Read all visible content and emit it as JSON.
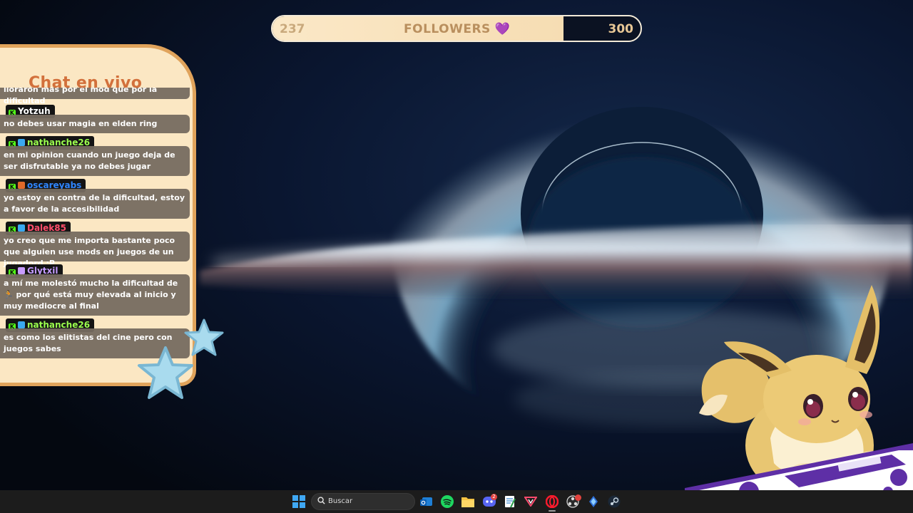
{
  "followers": {
    "current": "237",
    "label": "FOLLOWERS",
    "heart": "💜",
    "goal": "300",
    "progress": 0.79
  },
  "chat": {
    "title": "Chat en vivo",
    "truncated_line": "lloraron más por el mod que por la dificultad",
    "messages": [
      {
        "user": "Yotzuh",
        "user_color": "#ffffff",
        "badges": [
          "kick"
        ],
        "text": "no debes usar magia en elden ring"
      },
      {
        "user": "nathanche26",
        "user_color": "#9bff4e",
        "badges": [
          "kick",
          "sub"
        ],
        "text": "en mi opinion cuando un juego deja de ser disfrutable ya no debes jugar"
      },
      {
        "user": "oscareyabs",
        "user_color": "#2f86ff",
        "badges": [
          "kick",
          "fire"
        ],
        "text": "yo estoy en contra de la dificultad, estoy a favor de la accesibilidad"
      },
      {
        "user": "Dalek85",
        "user_color": "#ff4f6c",
        "badges": [
          "kick",
          "sub"
        ],
        "text": "yo creo que me importa bastante poco que alguien use mods en juegos de un jugadord :P"
      },
      {
        "user": "Glytxil",
        "user_color": "#c49bff",
        "badges": [
          "kick",
          "gift"
        ],
        "text": "a mí me molestó mucho la dificultad de 🏃 por qué está muy elevada al inicio y muy mediocre al final"
      },
      {
        "user": "nathanche26",
        "user_color": "#9bff4e",
        "badges": [
          "kick",
          "sub"
        ],
        "text": "es como los elitistas del cine pero con juegos sabes"
      }
    ]
  },
  "taskbar": {
    "search_placeholder": "Buscar",
    "discord_badge": "2",
    "icons": [
      "windows-start-icon",
      "search-icon",
      "outlook-icon",
      "spotify-icon",
      "file-explorer-icon",
      "discord-icon",
      "notepad-icon",
      "streamlabs-icon",
      "opera-icon",
      "obs-icon",
      "diamond-app-icon",
      "steam-icon"
    ]
  },
  "colors": {
    "panel_bg": "#fbe7c3",
    "panel_border": "#e0a35b",
    "title": "#d2703b",
    "bar_fill": "#fbe8c7",
    "taskbar": "#1c1c1c"
  }
}
